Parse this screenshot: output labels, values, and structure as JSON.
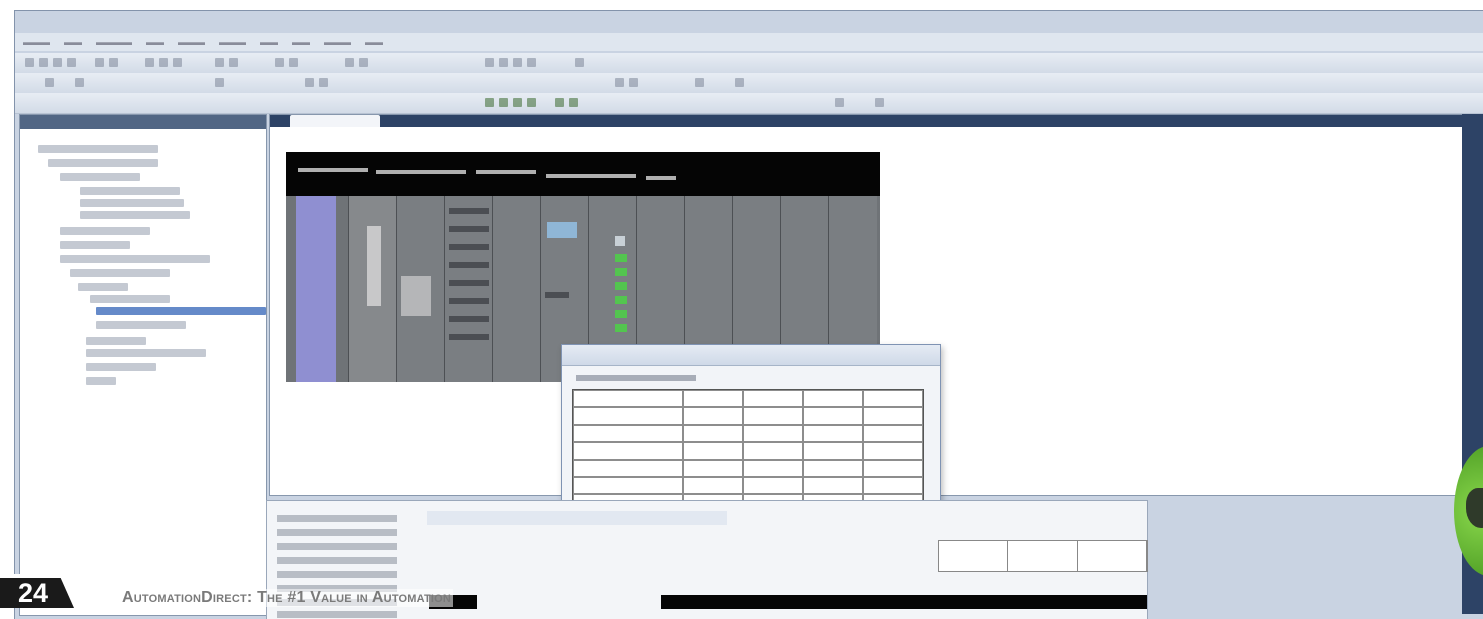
{
  "footer": {
    "page_number": "24",
    "tagline": "AutomationDirect: The #1 Value in Automation"
  },
  "colors": {
    "app_chrome": "#c9d3e2",
    "panel_header": "#2d4366",
    "rack_psu": "#8f8fd1",
    "led_green": "#53c54f",
    "emblem_green": "#6fc23a"
  },
  "icons": {
    "emblem": "green-globe-logo-icon"
  }
}
